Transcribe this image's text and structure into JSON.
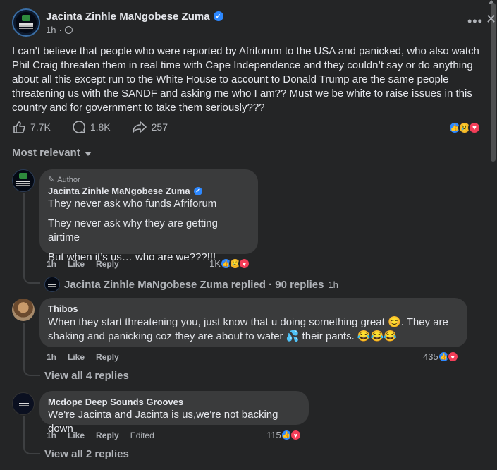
{
  "post": {
    "author": "Jacinta Zinhle MaNgobese Zuma",
    "time": "1h",
    "text": "I can’t believe that people who were reported by Afriforum to the USA and panicked, who also watch Phil Craig threaten them in real time with Cape Independence and they couldn’t say or do anything about all this except run to the White House to account to Donald Trump are the same people threatening us with the SANDF and asking me who I am?? Must we be white to raise issues in this country and for government to take them seriously???",
    "likes": "7.7K",
    "comments": "1.8K",
    "shares": "257"
  },
  "sort_label": "Most relevant",
  "comments": [
    {
      "tag": "Author",
      "name": "Jacinta Zinhle MaNgobese Zuma",
      "lines": [
        "They never ask who funds Afriforum",
        "They never ask why they are getting airtime",
        "But when it’s us… who are we???!!!"
      ],
      "time": "1h",
      "like": "Like",
      "reply": "Reply",
      "reactions": "1K",
      "replied_name": "Jacinta Zinhle MaNgobese Zuma replied · 90 replies",
      "replied_time": "1h"
    },
    {
      "name": "Thibos",
      "text": "When they start threatening you, just know that u doing something great 😊. They are shaking and panicking coz they are about to water 💦 their pants. 😂😂😂",
      "time": "1h",
      "like": "Like",
      "reply": "Reply",
      "reactions": "435",
      "view_replies": "View all 4 replies"
    },
    {
      "name": "Mcdope Deep Sounds Grooves",
      "text": "We're Jacinta and Jacinta is us,we're not backing down",
      "time": "1h",
      "like": "Like",
      "reply": "Reply",
      "edited": "Edited",
      "reactions": "115",
      "view_replies": "View all 2 replies"
    }
  ],
  "colors": {
    "background": "#242526",
    "bubble": "#3a3b3c",
    "accent": "#2d88ff"
  },
  "icons": [
    "like-icon",
    "comment-icon",
    "share-icon",
    "verified-icon",
    "globe-icon",
    "more-icon",
    "close-icon"
  ]
}
